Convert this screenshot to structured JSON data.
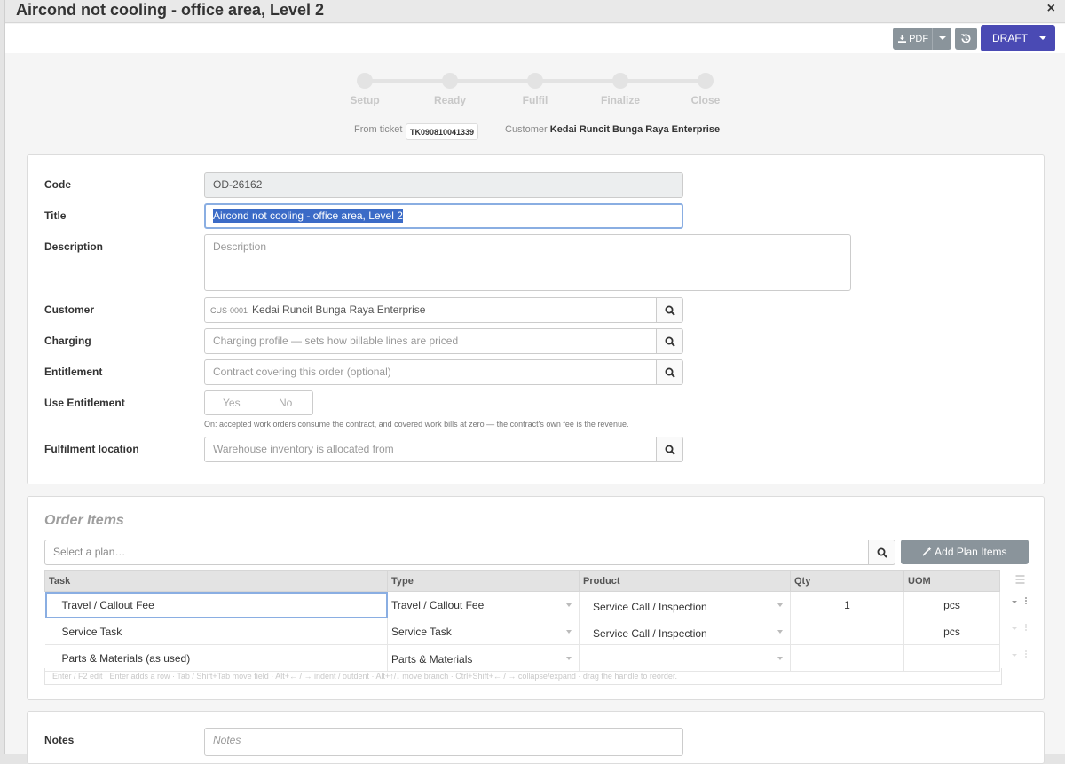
{
  "window": {
    "title": "Aircond not cooling - office area, Level 2",
    "close_label": "×"
  },
  "toolbar": {
    "pdf_label": "PDF",
    "draft_label": "DRAFT"
  },
  "stepper": {
    "steps": [
      "Setup",
      "Ready",
      "Fulfil",
      "Finalize",
      "Close"
    ]
  },
  "meta": {
    "from_ticket_label": "From ticket",
    "ticket": "TK090810041339",
    "customer_label": "Customer",
    "customer": "Kedai Runcit Bunga Raya Enterprise"
  },
  "form": {
    "code": {
      "label": "Code",
      "value": "OD-26162"
    },
    "title": {
      "label": "Title",
      "value": "Aircond not cooling - office area, Level 2"
    },
    "description": {
      "label": "Description",
      "placeholder": "Description"
    },
    "customer": {
      "label": "Customer",
      "code": "CUS-0001",
      "value": "Kedai Runcit Bunga Raya Enterprise"
    },
    "charging": {
      "label": "Charging",
      "placeholder": "Charging profile — sets how billable lines are priced"
    },
    "entitlement": {
      "label": "Entitlement",
      "placeholder": "Contract covering this order (optional)"
    },
    "use_entitlement": {
      "label": "Use Entitlement",
      "yes": "Yes",
      "no": "No",
      "help": "On: accepted work orders consume the contract, and covered work bills at zero — the contract's own fee is the revenue."
    },
    "fulfilment": {
      "label": "Fulfilment location",
      "placeholder": "Warehouse inventory is allocated from"
    }
  },
  "order_items": {
    "title": "Order Items",
    "plan_placeholder": "Select a plan…",
    "add_plan_label": "Add Plan Items",
    "columns": [
      "Task",
      "Type",
      "Product",
      "Qty",
      "UOM"
    ],
    "rows": [
      {
        "task": "Travel / Callout Fee",
        "type": "Travel / Callout Fee",
        "product": "Service Call / Inspection",
        "qty": "1",
        "uom": "pcs"
      },
      {
        "task": "Service Task",
        "type": "Service Task",
        "product": "Service Call / Inspection",
        "qty": "",
        "uom": "pcs"
      },
      {
        "task": "Parts & Materials (as used)",
        "type": "Parts & Materials",
        "product": "",
        "qty": "",
        "uom": ""
      }
    ],
    "keyboard_help": "Enter / F2 edit · Enter adds a row · Tab / Shift+Tab move field · Alt+← / → indent / outdent · Alt+↑/↓ move branch · Ctrl+Shift+← / → collapse/expand · drag the handle to reorder."
  },
  "notes": {
    "label": "Notes",
    "placeholder": "Notes"
  }
}
